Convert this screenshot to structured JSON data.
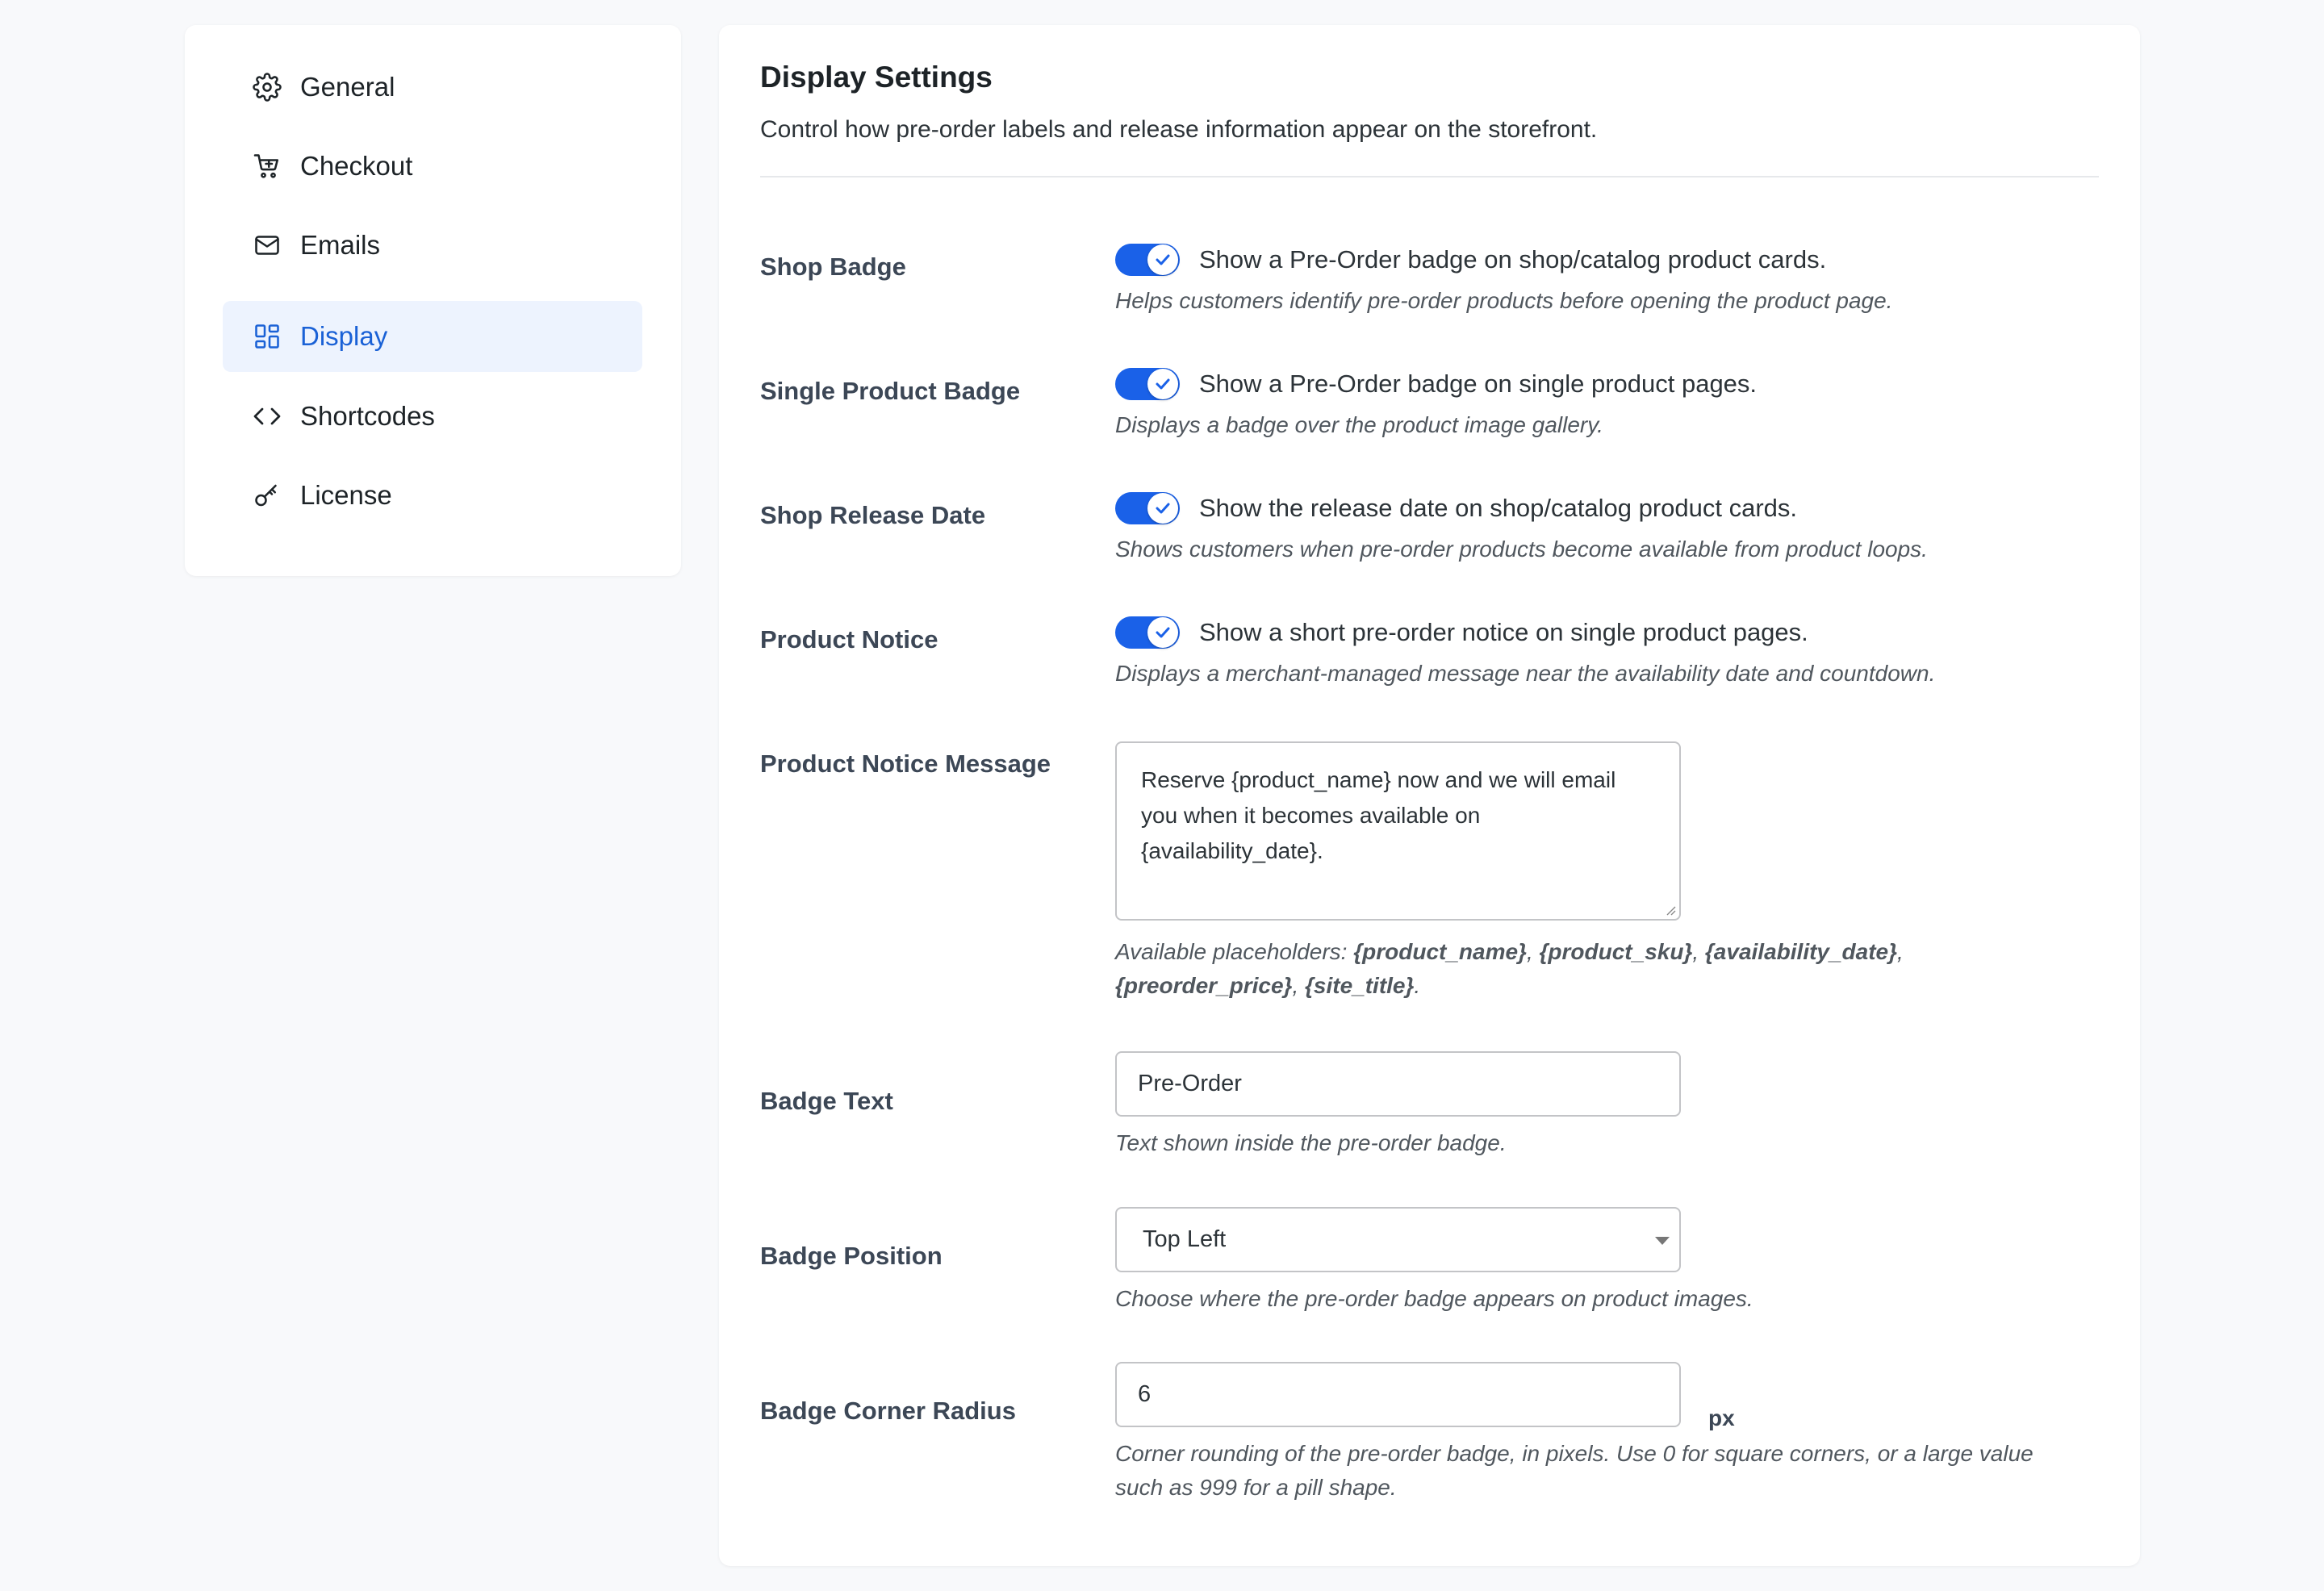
{
  "sidebar": {
    "items": [
      {
        "label": "General",
        "icon": "gear-icon",
        "active": false
      },
      {
        "label": "Checkout",
        "icon": "cart-icon",
        "active": false
      },
      {
        "label": "Emails",
        "icon": "mail-icon",
        "active": false
      },
      {
        "label": "Display",
        "icon": "layout-grid-icon",
        "active": true
      },
      {
        "label": "Shortcodes",
        "icon": "code-icon",
        "active": false
      },
      {
        "label": "License",
        "icon": "key-icon",
        "active": false
      }
    ]
  },
  "main": {
    "title": "Display Settings",
    "description": "Control how pre-order labels and release information appear on the storefront.",
    "shop_badge": {
      "label": "Shop Badge",
      "toggle_label": "Show a Pre-Order badge on shop/catalog product cards.",
      "help": "Helps customers identify pre-order products before opening the product page.",
      "enabled": true
    },
    "single_product_badge": {
      "label": "Single Product Badge",
      "toggle_label": "Show a Pre-Order badge on single product pages.",
      "help": "Displays a badge over the product image gallery.",
      "enabled": true
    },
    "shop_release_date": {
      "label": "Shop Release Date",
      "toggle_label": "Show the release date on shop/catalog product cards.",
      "help": "Shows customers when pre-order products become available from product loops.",
      "enabled": true
    },
    "product_notice": {
      "label": "Product Notice",
      "toggle_label": "Show a short pre-order notice on single product pages.",
      "help": "Displays a merchant-managed message near the availability date and countdown.",
      "enabled": true
    },
    "product_notice_message": {
      "label": "Product Notice Message",
      "value": "Reserve {product_name} now and we will email you when it becomes available on {availability_date}.",
      "help_prefix": "Available placeholders: ",
      "placeholders": [
        "{product_name}",
        "{product_sku}",
        "{availability_date}",
        "{preorder_price}",
        "{site_title}"
      ],
      "sep": ", ",
      "end": "."
    },
    "badge_text": {
      "label": "Badge Text",
      "value": "Pre-Order",
      "help": "Text shown inside the pre-order badge."
    },
    "badge_position": {
      "label": "Badge Position",
      "value": "Top Left",
      "help": "Choose where the pre-order badge appears on product images."
    },
    "badge_corner_radius": {
      "label": "Badge Corner Radius",
      "value": "6",
      "unit": "px",
      "help": "Corner rounding of the pre-order badge, in pixels. Use 0 for square corners, or a large value such as 999 for a pill shape."
    }
  },
  "colors": {
    "accent": "#1a61e8",
    "active_bg": "#edf3fe",
    "active_text": "#1a61d6"
  }
}
